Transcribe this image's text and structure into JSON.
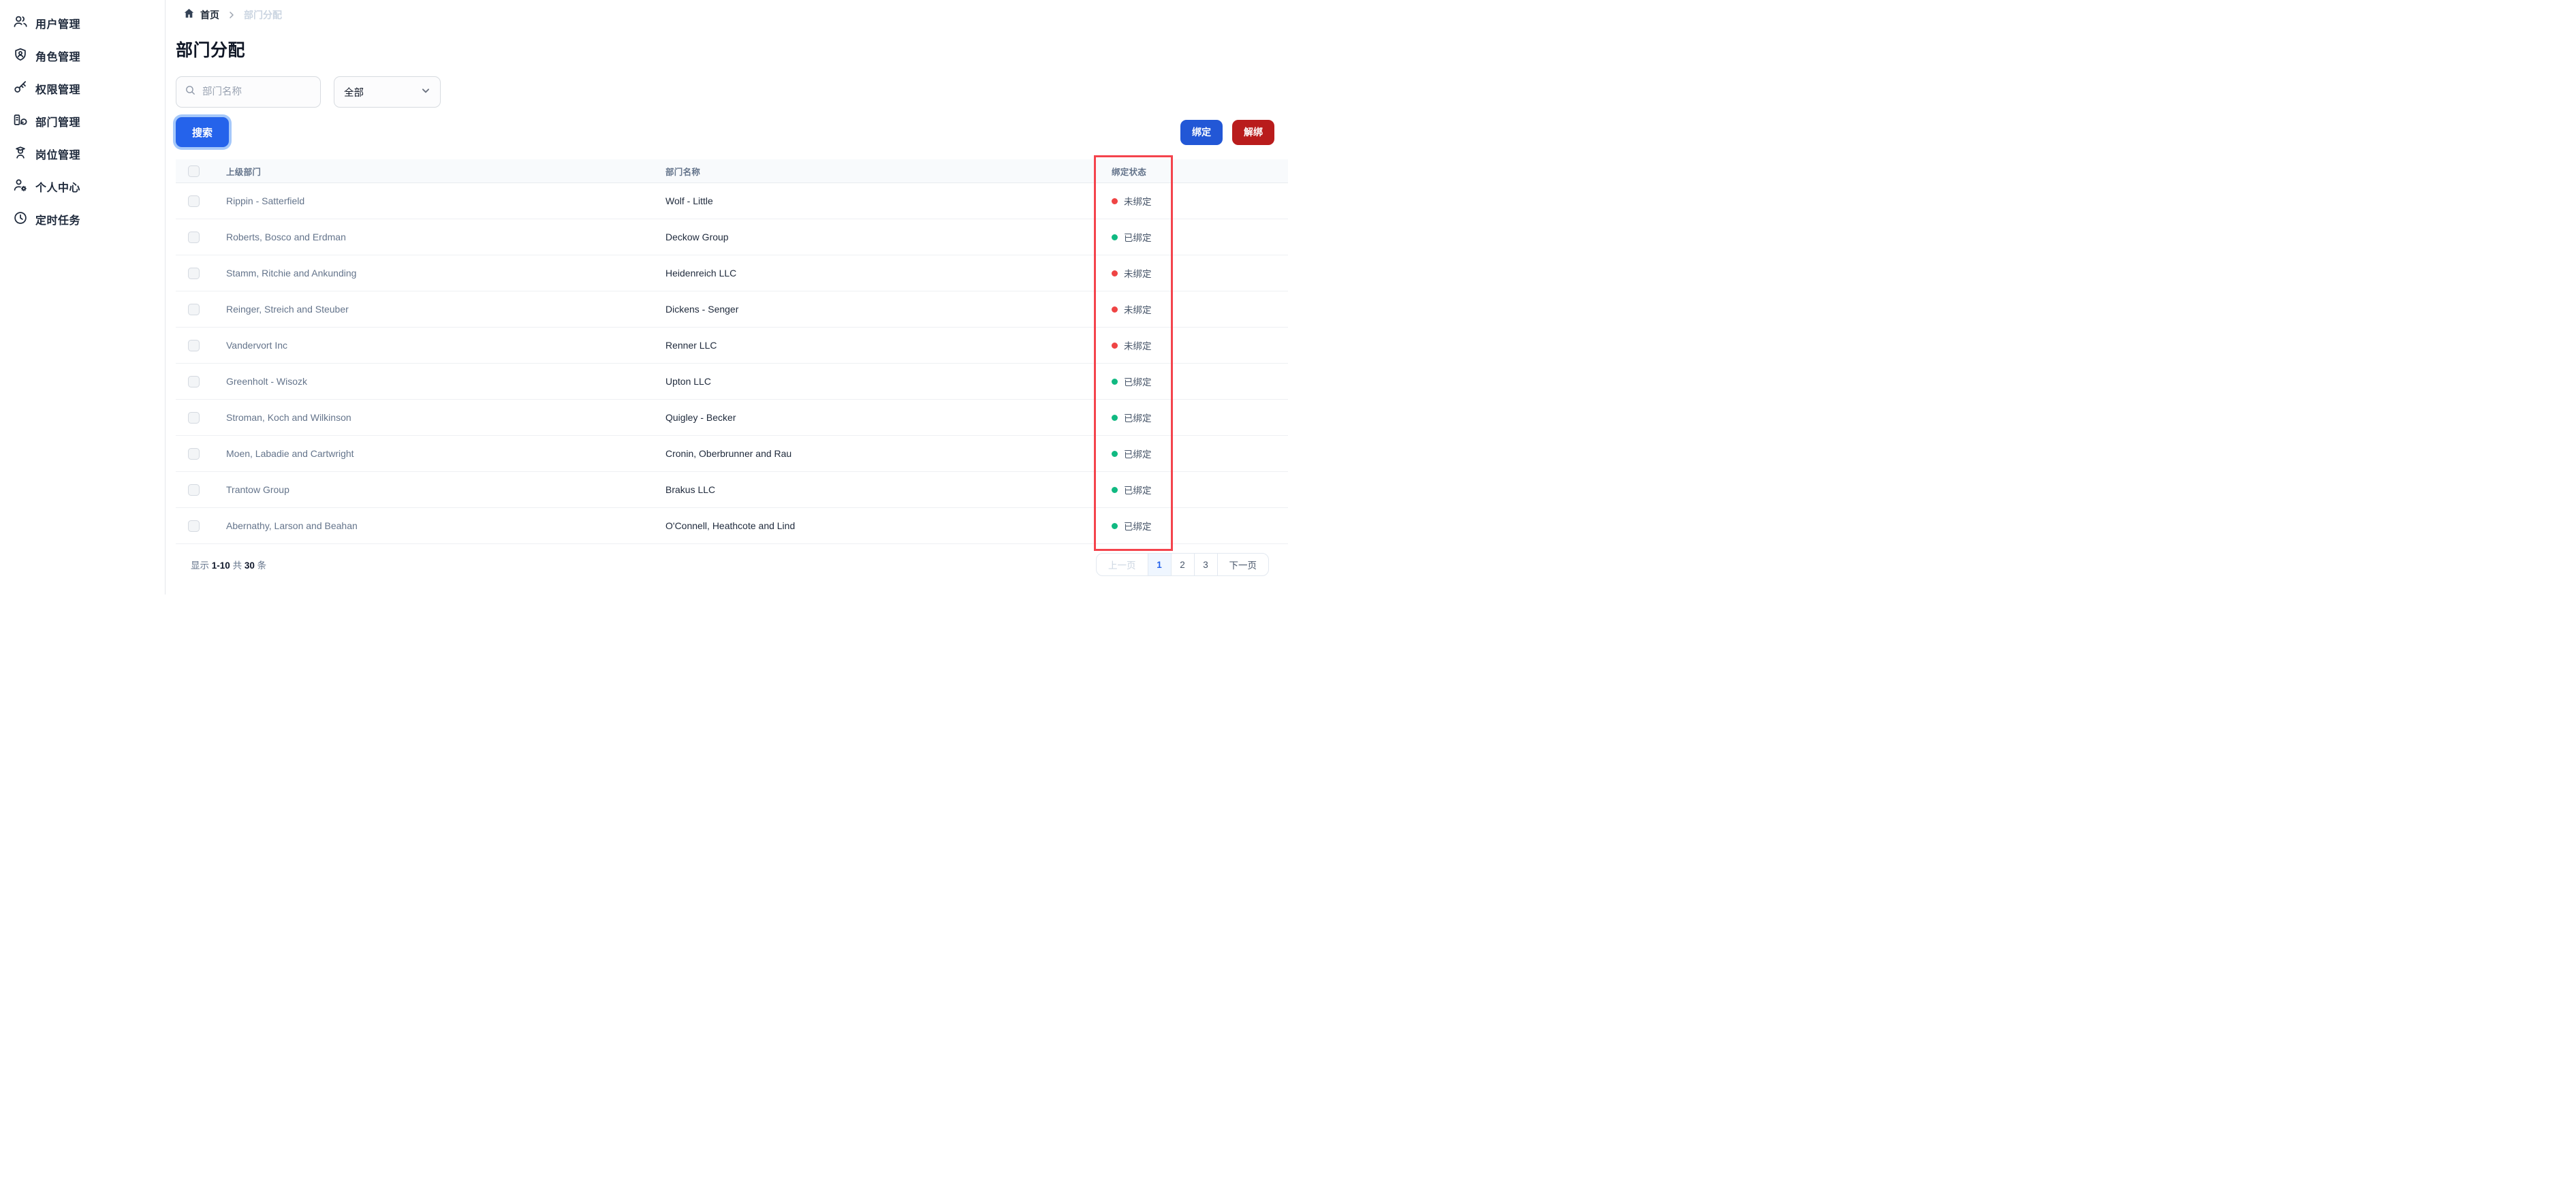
{
  "sidebar": {
    "items": [
      {
        "icon": "users-icon",
        "label": "用户管理"
      },
      {
        "icon": "role-shield-icon",
        "label": "角色管理"
      },
      {
        "icon": "key-icon",
        "label": "权限管理"
      },
      {
        "icon": "department-icon",
        "label": "部门管理"
      },
      {
        "icon": "position-icon",
        "label": "岗位管理"
      },
      {
        "icon": "user-settings-icon",
        "label": "个人中心"
      },
      {
        "icon": "clock-icon",
        "label": "定时任务"
      }
    ]
  },
  "breadcrumb": {
    "home": "首页",
    "current": "部门分配"
  },
  "page": {
    "title": "部门分配"
  },
  "filters": {
    "search_placeholder": "部门名称",
    "search_value": "",
    "category_selected": "全部",
    "search_button": "搜索"
  },
  "actions": {
    "bind": "绑定",
    "unbind": "解绑"
  },
  "table": {
    "headers": {
      "parent": "上级部门",
      "name": "部门名称",
      "status": "绑定状态"
    },
    "rows": [
      {
        "parent": "Rippin - Satterfield",
        "name": "Wolf - Little",
        "status": "未绑定",
        "bound": false
      },
      {
        "parent": "Roberts, Bosco and Erdman",
        "name": "Deckow Group",
        "status": "已绑定",
        "bound": true
      },
      {
        "parent": "Stamm, Ritchie and Ankunding",
        "name": "Heidenreich LLC",
        "status": "未绑定",
        "bound": false
      },
      {
        "parent": "Reinger, Streich and Steuber",
        "name": "Dickens - Senger",
        "status": "未绑定",
        "bound": false
      },
      {
        "parent": "Vandervort Inc",
        "name": "Renner LLC",
        "status": "未绑定",
        "bound": false
      },
      {
        "parent": "Greenholt - Wisozk",
        "name": "Upton LLC",
        "status": "已绑定",
        "bound": true
      },
      {
        "parent": "Stroman, Koch and Wilkinson",
        "name": "Quigley - Becker",
        "status": "已绑定",
        "bound": true
      },
      {
        "parent": "Moen, Labadie and Cartwright",
        "name": "Cronin, Oberbrunner and Rau",
        "status": "已绑定",
        "bound": true
      },
      {
        "parent": "Trantow Group",
        "name": "Brakus LLC",
        "status": "已绑定",
        "bound": true
      },
      {
        "parent": "Abernathy, Larson and Beahan",
        "name": "O'Connell, Heathcote and Lind",
        "status": "已绑定",
        "bound": true
      }
    ]
  },
  "footer": {
    "label_show": "显示",
    "range": "1-10",
    "label_total": "共",
    "total": "30",
    "label_unit": "条"
  },
  "pagination": {
    "prev": "上一页",
    "pages": [
      "1",
      "2",
      "3"
    ],
    "active_page": "1",
    "next": "下一页"
  },
  "colors": {
    "accent_blue": "#2563eb",
    "bind_blue": "#2257d6",
    "unbind_red": "#b91c1c",
    "status_unbound_dot": "#ef4444",
    "status_bound_dot": "#10b981",
    "highlight_box_red": "#f4434c",
    "active_page_bg": "#eff6ff"
  }
}
